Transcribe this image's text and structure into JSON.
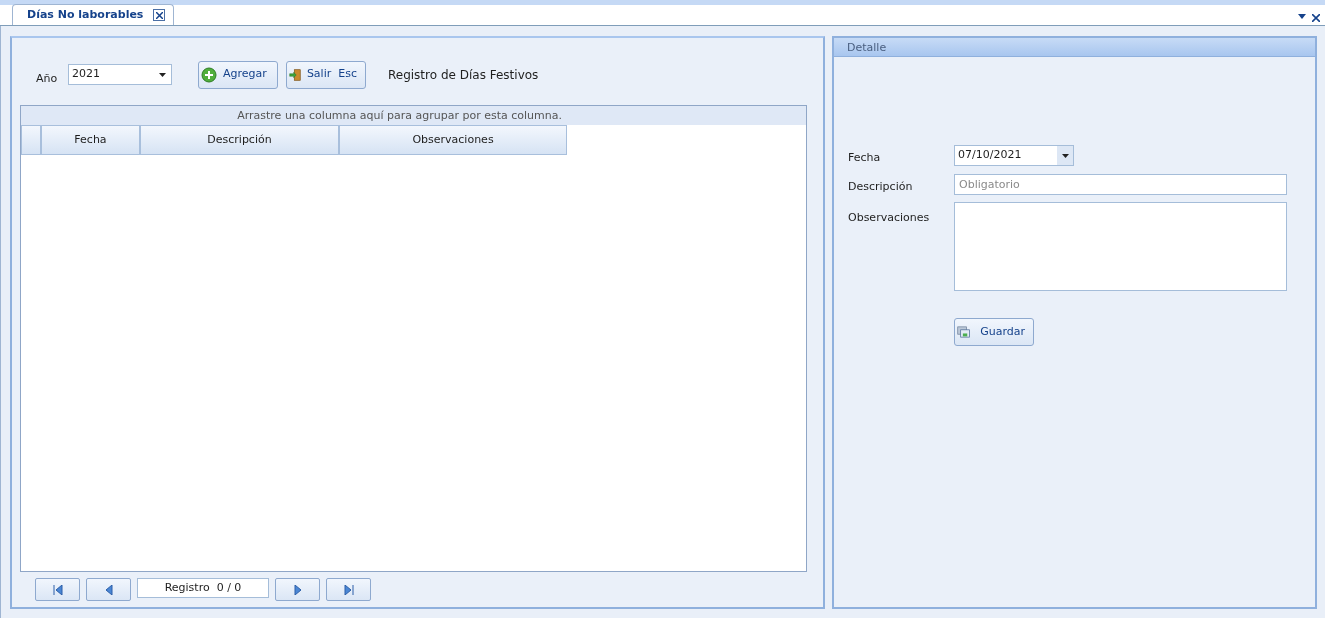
{
  "tabs": [
    {
      "label": "Días No laborables",
      "selected": true
    }
  ],
  "toolbar": {
    "year_label": "Año",
    "year_value": "2021",
    "buttons": [
      {
        "label": "Agregar",
        "kind": "add"
      },
      {
        "label": "Salir  Esc",
        "kind": "exit"
      }
    ],
    "heading": "Registro de Días Festivos"
  },
  "grid": {
    "group_hint": "Arrastre una columna aquí para agrupar por esta columna.",
    "columns": [
      "Fecha",
      "Descripción",
      "Observaciones"
    ]
  },
  "pager": {
    "buttons": [
      {
        "kind": "first"
      },
      {
        "kind": "prev"
      },
      {
        "kind": "next"
      },
      {
        "kind": "last"
      }
    ],
    "label": "Registro  0 / 0"
  },
  "detail": {
    "title": "Detalle",
    "fields": [
      {
        "label": "Fecha",
        "kind": "date",
        "value": "07/10/2021"
      },
      {
        "label": "Descripción",
        "kind": "text",
        "placeholder": "Obligatorio"
      },
      {
        "label": "Observaciones",
        "kind": "memo"
      }
    ],
    "save_button": "Guardar"
  }
}
